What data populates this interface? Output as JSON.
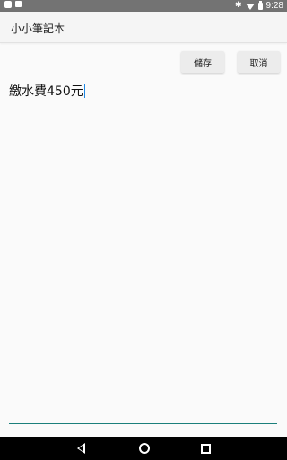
{
  "status_bar": {
    "time": "9:28",
    "icons_left": [
      "android-icon",
      "notification-icon"
    ],
    "icons_right": [
      "bluetooth-icon",
      "wifi-icon",
      "battery-icon"
    ]
  },
  "app_bar": {
    "title": "小小筆記本"
  },
  "actions": {
    "save_label": "儲存",
    "cancel_label": "取消"
  },
  "note": {
    "text": "繳水費450元"
  },
  "colors": {
    "status_bar": "#737373",
    "app_bar": "#f5f5f5",
    "accent": "#1b7f7b",
    "cursor": "#1e88e5",
    "nav_bar": "#000000"
  }
}
